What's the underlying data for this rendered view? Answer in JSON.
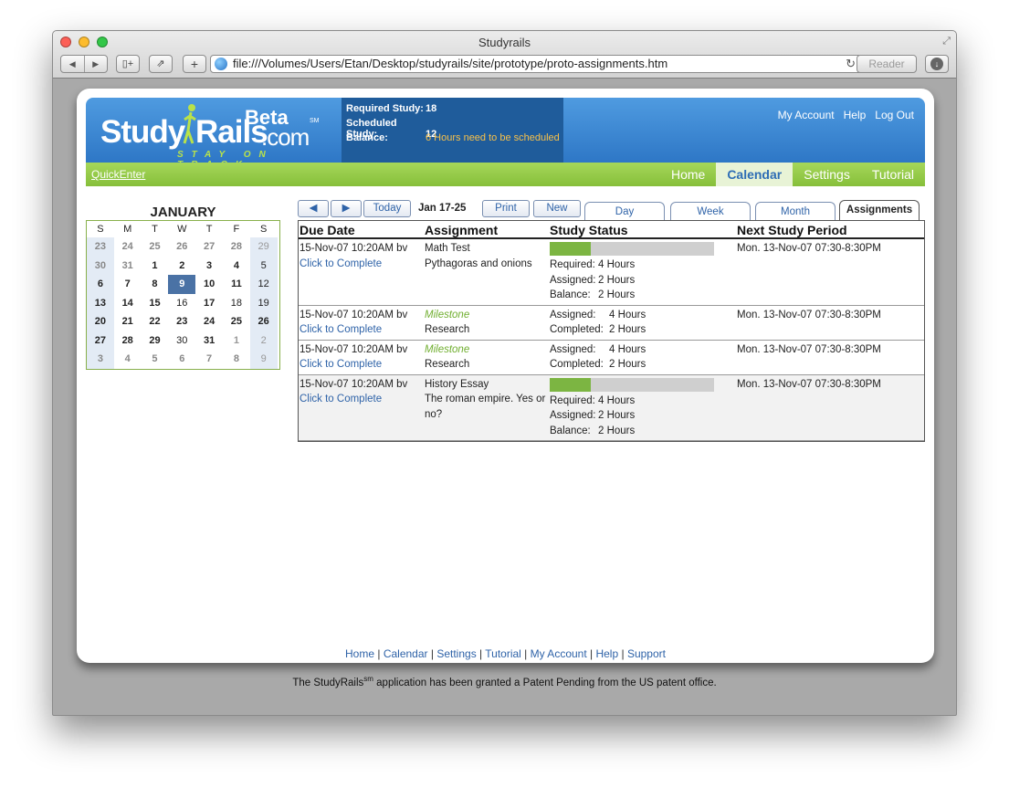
{
  "browser": {
    "title": "Studyrails",
    "url": "file:///Volumes/Users/Etan/Desktop/studyrails/site/prototype/proto-assignments.htm",
    "reader_label": "Reader"
  },
  "header": {
    "logo": {
      "study": "Study",
      "rails": "Rails",
      "beta": "Beta",
      "sm": "SM",
      "com": ".com",
      "tagline": "STAY ON TRACK"
    },
    "study_box": {
      "required_label": "Required Study:",
      "required_value": "18",
      "scheduled_label": "Scheduled Study:",
      "scheduled_value": "12",
      "balance_label": "Balance:",
      "balance_value": "6 Hours need to be scheduled"
    },
    "links": {
      "account": "My Account",
      "help": "Help",
      "logout": "Log Out"
    },
    "warn_color": "#f7c04a"
  },
  "navbar": {
    "quickenter": "QuickEnter",
    "items": [
      "Home",
      "Calendar",
      "Settings",
      "Tutorial"
    ],
    "active": "Calendar"
  },
  "mini_calendar": {
    "month": "JANUARY",
    "weekdays": [
      "S",
      "M",
      "T",
      "W",
      "T",
      "F",
      "S"
    ],
    "weeks": [
      [
        "23",
        "24",
        "25",
        "26",
        "27",
        "28",
        "29"
      ],
      [
        "30",
        "31",
        "1",
        "2",
        "3",
        "4",
        "5"
      ],
      [
        "6",
        "7",
        "8",
        "9",
        "10",
        "11",
        "12"
      ],
      [
        "13",
        "14",
        "15",
        "16",
        "17",
        "18",
        "19"
      ],
      [
        "20",
        "21",
        "22",
        "23",
        "24",
        "25",
        "26"
      ],
      [
        "27",
        "28",
        "29",
        "30",
        "31",
        "1",
        "2"
      ],
      [
        "3",
        "4",
        "5",
        "6",
        "7",
        "8",
        "9"
      ]
    ],
    "selected_day": "9"
  },
  "controls": {
    "prev_icon": "prev-arrow-icon",
    "next_icon": "next-arrow-icon",
    "today": "Today",
    "range": "Jan 17-25",
    "print": "Print",
    "new": "New",
    "tabs": [
      "Day",
      "Week",
      "Month",
      "Assignments"
    ],
    "active_tab": "Assignments"
  },
  "table": {
    "headers": [
      "Due Date",
      "Assignment",
      "Study Status",
      "Next Study Period"
    ],
    "rows": [
      {
        "due": "15-Nov-07 10:20AM bv",
        "action": "Click to Complete",
        "assignment": "Math Test",
        "detail": "Pythagoras and onions",
        "progress": 0.25,
        "status": [
          [
            "Required:",
            "4 Hours"
          ],
          [
            "Assigned:",
            "2 Hours"
          ],
          [
            "Balance:",
            "2 Hours"
          ]
        ],
        "next": "Mon. 13-Nov-07 07:30-8:30PM"
      },
      {
        "due": "15-Nov-07 10:20AM bv",
        "action": "Click to Complete",
        "assignment": "Milestone",
        "detail": "Research",
        "status": [
          [
            "Assigned:",
            "4 Hours"
          ],
          [
            "Completed:",
            "2 Hours"
          ]
        ],
        "next": "Mon. 13-Nov-07 07:30-8:30PM"
      },
      {
        "due": "15-Nov-07 10:20AM bv",
        "action": "Click to Complete",
        "assignment": "Milestone",
        "detail": "Research",
        "status": [
          [
            "Assigned:",
            "4 Hours"
          ],
          [
            "Completed:",
            "2 Hours"
          ]
        ],
        "next": "Mon. 13-Nov-07 07:30-8:30PM"
      },
      {
        "due": "15-Nov-07 10:20AM bv",
        "action": "Click to Complete",
        "assignment": "History Essay",
        "detail": "The roman empire. Yes or no?",
        "progress": 0.25,
        "status": [
          [
            "Required:",
            "4 Hours"
          ],
          [
            "Assigned:",
            "2 Hours"
          ],
          [
            "Balance:",
            "2 Hours"
          ]
        ],
        "next": "Mon. 13-Nov-07 07:30-8:30PM"
      }
    ]
  },
  "footer": {
    "links": [
      "Home",
      "Calendar",
      "Settings",
      "Tutorial",
      "My Account",
      "Help",
      "Support"
    ],
    "patent_pre": "The StudyRails",
    "patent_sup": "sm",
    "patent_post": " application has been granted a Patent Pending from the US patent office."
  }
}
